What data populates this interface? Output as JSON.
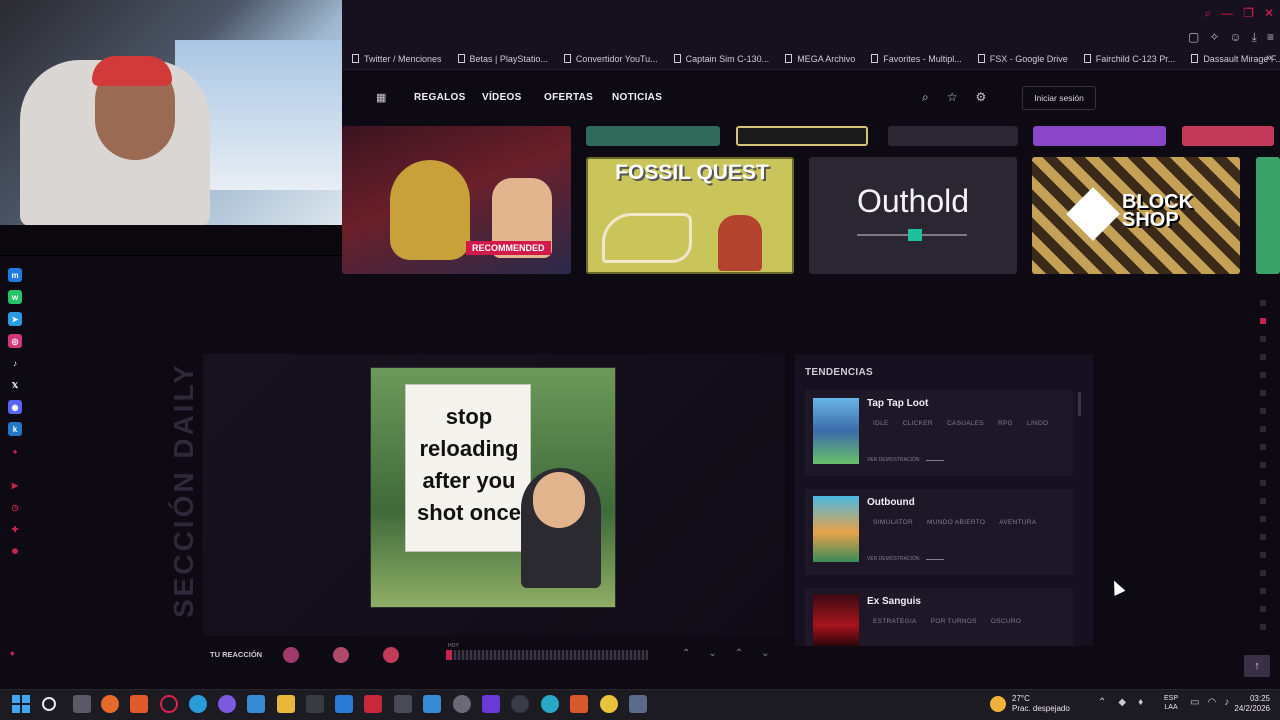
{
  "bookmarks": [
    {
      "label": "Twitter / Menciones"
    },
    {
      "label": "Betas | PlayStatio..."
    },
    {
      "label": "Convertidor YouTu..."
    },
    {
      "label": "Captain Sim C-130..."
    },
    {
      "label": "MEGA Archivo"
    },
    {
      "label": "Favorites - Multipl..."
    },
    {
      "label": "FSX - Google Drive"
    },
    {
      "label": "Fairchild C-123 Pr..."
    },
    {
      "label": "Dassault Mirage F..."
    }
  ],
  "nav": {
    "links": [
      "REGALOS",
      "VÍDEOS",
      "OFERTAS",
      "NOTICIAS"
    ],
    "login_label": "Iniciar sesión"
  },
  "carousel": {
    "recommended_badge": "RECOMMENDED",
    "tiles": [
      {
        "title": "FOSSIL QUEST"
      },
      {
        "title": "Outhold"
      },
      {
        "title": "BLOCK SHOP"
      }
    ]
  },
  "daily": {
    "section_label": "SECCIÓN DAILY",
    "meme_text": "stop reloading after you shot once",
    "reaction_label": "TU REACCIÓN",
    "timeline_label": "HOY"
  },
  "trends": {
    "title": "TENDENCIAS",
    "demo_label": "VER DEMOSTRACIÓN",
    "items": [
      {
        "name": "Tap Tap Loot",
        "tags": [
          "IDLE",
          "CLICKER",
          "CASUALES",
          "RPG",
          "LINDO"
        ]
      },
      {
        "name": "Outbound",
        "tags": [
          "SIMULATOR",
          "MUNDO ABIERTO",
          "AVENTURA"
        ]
      },
      {
        "name": "Ex Sanguis",
        "tags": [
          "ESTRATEGIA",
          "POR TURNOS",
          "OSCURO"
        ]
      }
    ]
  },
  "taskbar": {
    "weather_temp": "27°C",
    "weather_desc": "Prac. despejado",
    "lang_top": "ESP",
    "lang_bottom": "LAA",
    "time": "03:25",
    "date": "24/2/2026"
  },
  "colors": {
    "accent": "#c7244d",
    "background": "#0d0a14",
    "panel": "#161120"
  }
}
